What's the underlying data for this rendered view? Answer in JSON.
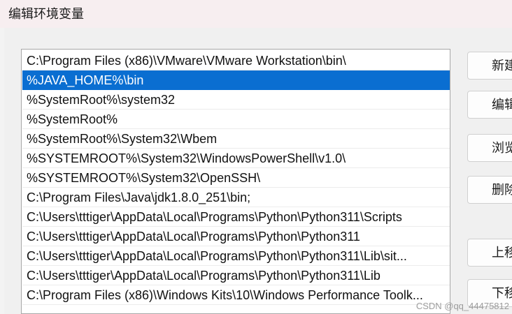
{
  "window": {
    "title": "编辑环境变量"
  },
  "path_list": {
    "items": [
      {
        "text": "C:\\Program Files (x86)\\VMware\\VMware Workstation\\bin\\",
        "selected": false
      },
      {
        "text": "%JAVA_HOME%\\bin",
        "selected": true
      },
      {
        "text": "%SystemRoot%\\system32",
        "selected": false
      },
      {
        "text": "%SystemRoot%",
        "selected": false
      },
      {
        "text": "%SystemRoot%\\System32\\Wbem",
        "selected": false
      },
      {
        "text": "%SYSTEMROOT%\\System32\\WindowsPowerShell\\v1.0\\",
        "selected": false
      },
      {
        "text": "%SYSTEMROOT%\\System32\\OpenSSH\\",
        "selected": false
      },
      {
        "text": "C:\\Program Files\\Java\\jdk1.8.0_251\\bin;",
        "selected": false
      },
      {
        "text": "C:\\Users\\tttiger\\AppData\\Local\\Programs\\Python\\Python311\\Scripts",
        "selected": false
      },
      {
        "text": "C:\\Users\\tttiger\\AppData\\Local\\Programs\\Python\\Python311",
        "selected": false
      },
      {
        "text": "C:\\Users\\tttiger\\AppData\\Local\\Programs\\Python\\Python311\\Lib\\sit...",
        "selected": false
      },
      {
        "text": "C:\\Users\\tttiger\\AppData\\Local\\Programs\\Python\\Python311\\Lib",
        "selected": false
      },
      {
        "text": "C:\\Program Files (x86)\\Windows Kits\\10\\Windows Performance Toolk...",
        "selected": false
      }
    ]
  },
  "buttons": {
    "new_label": "新建",
    "edit_label": "编辑",
    "browse_label": "浏览",
    "delete_label": "删除",
    "move_up_label": "上移",
    "move_down_label": "下移"
  },
  "watermark": "CSDN @qq_44475812"
}
